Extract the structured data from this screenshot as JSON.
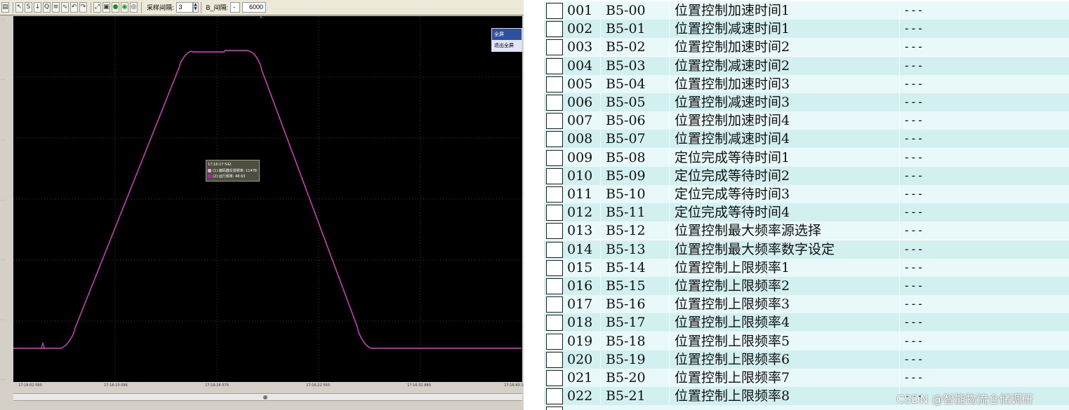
{
  "scope": {
    "toolbar": {
      "sample_interval_label": "采样间隔:",
      "sample_interval_value": "3",
      "b_axis_label": "B_间隔:",
      "b_axis_value": "6000"
    },
    "fullscreen_menu": {
      "title": "全屏",
      "exit": "退出全屏"
    },
    "tooltip": {
      "time": "17:16:17 542",
      "rows": [
        {
          "text": "(1):编码器反馈频率: 11478",
          "color": "#f0a0c8"
        },
        {
          "text": "(2):运行频率: 48.63",
          "color": "#b01cb0"
        }
      ]
    },
    "x_ticks": [
      "17:16:02 090",
      "17:16:10 096",
      "17:16:16 570",
      "17:16:22 560",
      "17:16:32 880",
      "17:16:40 190"
    ],
    "trace_color": "#e040c8"
  },
  "params": {
    "rows": [
      {
        "num": "001",
        "code": "B5-00",
        "name": "位置控制加速时间1",
        "value": "---"
      },
      {
        "num": "002",
        "code": "B5-01",
        "name": "位置控制减速时间1",
        "value": "---"
      },
      {
        "num": "003",
        "code": "B5-02",
        "name": "位置控制加速时间2",
        "value": "---"
      },
      {
        "num": "004",
        "code": "B5-03",
        "name": "位置控制减速时间2",
        "value": "---"
      },
      {
        "num": "005",
        "code": "B5-04",
        "name": "位置控制加速时间3",
        "value": "---"
      },
      {
        "num": "006",
        "code": "B5-05",
        "name": "位置控制减速时间3",
        "value": "---"
      },
      {
        "num": "007",
        "code": "B5-06",
        "name": "位置控制加速时间4",
        "value": "---"
      },
      {
        "num": "008",
        "code": "B5-07",
        "name": "位置控制减速时间4",
        "value": "---"
      },
      {
        "num": "009",
        "code": "B5-08",
        "name": "定位完成等待时间1",
        "value": "---"
      },
      {
        "num": "010",
        "code": "B5-09",
        "name": "定位完成等待时间2",
        "value": "---"
      },
      {
        "num": "011",
        "code": "B5-10",
        "name": "定位完成等待时间3",
        "value": "---"
      },
      {
        "num": "012",
        "code": "B5-11",
        "name": "定位完成等待时间4",
        "value": "---"
      },
      {
        "num": "013",
        "code": "B5-12",
        "name": "位置控制最大频率源选择",
        "value": "---"
      },
      {
        "num": "014",
        "code": "B5-13",
        "name": "位置控制最大频率数字设定",
        "value": "---"
      },
      {
        "num": "015",
        "code": "B5-14",
        "name": "位置控制上限频率1",
        "value": "---"
      },
      {
        "num": "016",
        "code": "B5-15",
        "name": "位置控制上限频率2",
        "value": "---"
      },
      {
        "num": "017",
        "code": "B5-16",
        "name": "位置控制上限频率3",
        "value": "---"
      },
      {
        "num": "018",
        "code": "B5-17",
        "name": "位置控制上限频率4",
        "value": "---"
      },
      {
        "num": "019",
        "code": "B5-18",
        "name": "位置控制上限频率5",
        "value": "---"
      },
      {
        "num": "020",
        "code": "B5-19",
        "name": "位置控制上限频率6",
        "value": "---"
      },
      {
        "num": "021",
        "code": "B5-20",
        "name": "位置控制上限频率7",
        "value": "---"
      },
      {
        "num": "022",
        "code": "B5-21",
        "name": "位置控制上限频率8",
        "value": "---"
      }
    ]
  },
  "watermark": "CSDN @智能物流仓储调研"
}
